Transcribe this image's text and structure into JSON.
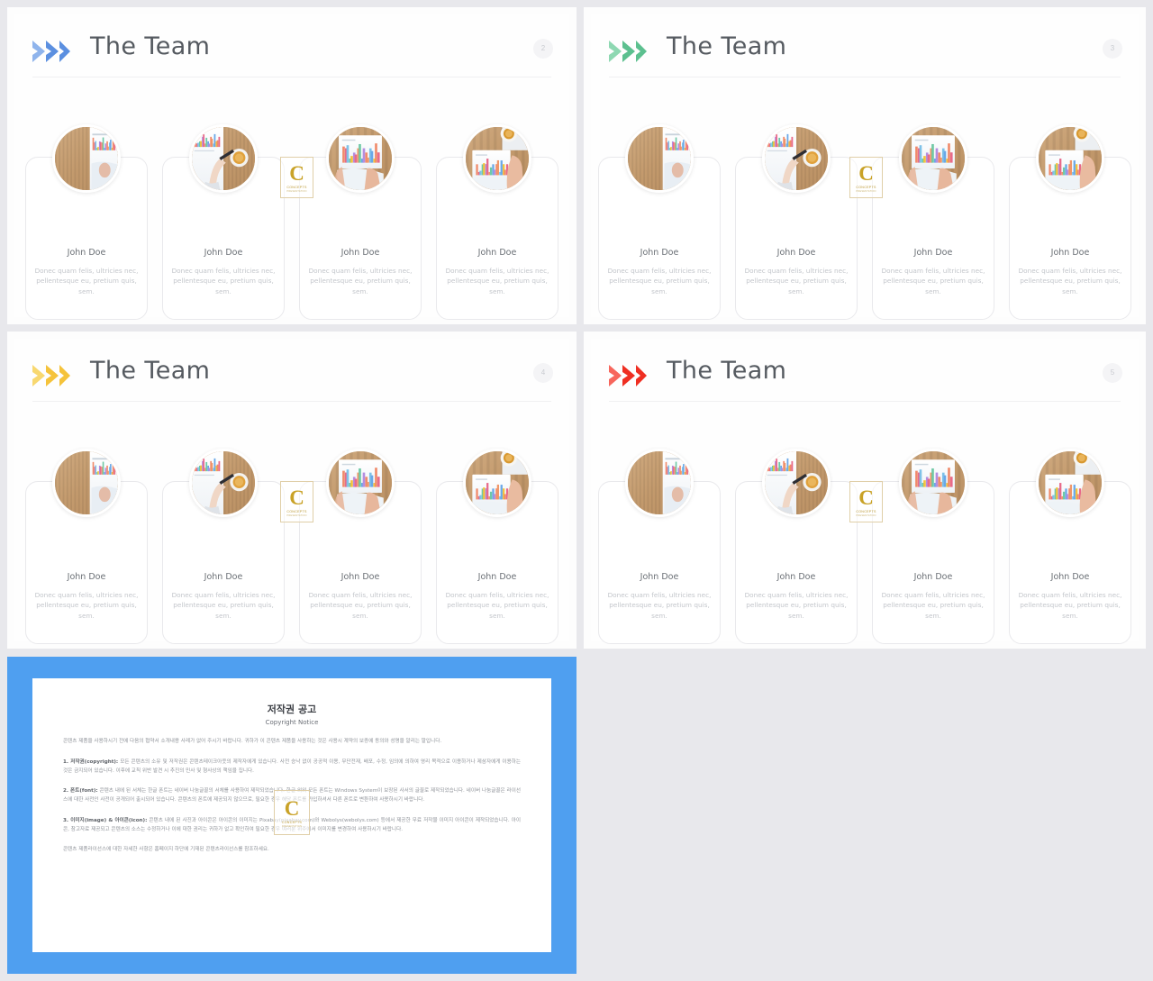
{
  "deck": {
    "slides": [
      {
        "page_number": "2",
        "title": "The Team",
        "accent": "#5b8fe0",
        "accent_light": "#8fb4ec",
        "chevron_icon": "double-chevron-right-icon"
      },
      {
        "page_number": "3",
        "title": "The Team",
        "accent": "#5cc08f",
        "accent_light": "#8ed8b2",
        "chevron_icon": "double-chevron-right-icon"
      },
      {
        "page_number": "4",
        "title": "The Team",
        "accent": "#f5c33b",
        "accent_light": "#f8d870",
        "chevron_icon": "double-chevron-right-icon"
      },
      {
        "page_number": "5",
        "title": "The Team",
        "accent": "#ef2f22",
        "accent_light": "#f7665c",
        "chevron_icon": "double-chevron-right-icon"
      }
    ],
    "members": [
      {
        "name": "John Doe",
        "description": "Donec quam felis, ultricies nec, pellentesque eu, pretium quis, sem.",
        "photo": "desk-wood-chart-paper"
      },
      {
        "name": "John Doe",
        "description": "Donec quam felis, ultricies nec, pellentesque eu, pretium quis, sem.",
        "photo": "hand-pen-chart-coffee"
      },
      {
        "name": "John Doe",
        "description": "Donec quam felis, ultricies nec, pellentesque eu, pretium quis, sem.",
        "photo": "hands-chart-paper-desk"
      },
      {
        "name": "John Doe",
        "description": "Donec quam felis, ultricies nec, pellentesque eu, pretium quis, sem.",
        "photo": "coffee-chart-hand-desk"
      }
    ],
    "watermark": {
      "letter": "C",
      "line1": "CONCEPTS",
      "line2": "PRESENTATION"
    }
  },
  "copyright": {
    "frame_color": "#4f9ff0",
    "heading_ko": "저작권 공고",
    "heading_en": "Copyright Notice",
    "intro": "콘텐츠 제품을 사용하시기 전에 다음의 협약서 소개내용 사례가 없어 주시기 바랍니다. 귀하가 이 콘텐츠 제품을 사용하는 것은 사용시 계약의 보증에 동의와 성명을 알리는 말입니다.",
    "sections": [
      {
        "label": "1. 저작권(copyright):",
        "text": " 모든 콘텐츠의 소유 및 저작권은 콘텐츠테이크아웃의 제작자에게 있습니다. 사전 승낙 없이 공공적 이용, 무단전재, 배포, 수정, 임의에 의하여 영리 목적으로 이용하거나 제삼자에게 이용하는 것은 금지되어 있습니다. 이후에 교칙 위반 발견 시 추진의 민사 및 형사상의 책임을 집니다."
      },
      {
        "label": "2. 폰트(font):",
        "text": " 콘텐츠 내에 된 서체는 한글 폰트는 네이버 나눔글꼴의 서체를 사용하여 제작되었습니다. 한글 외의 모든 폰트는 Windows System이 보장된 사서의 글꼴로 제작되었습니다. 네이버 나눔글꼴은 라이선스에 대한 사전인 사전이 공개되어 출시되어 있습니다. 콘텐츠의 폰트에 제공되지 않으므로, 필요한 경우 해당 폰트를 가입하셔서 다른 폰트로 변환하여 사용하시기 바랍니다."
      },
      {
        "label": "3. 이미지(image) & 아이콘(icon):",
        "text": " 콘텐츠 내에 된 사진과 아이콘은 아이콘의 이미지는 Pixabay(pixabay.com)와 Webolys(webolys.com) 등에서 제공한 무료 저작물 이미지 아이콘이 제작되었습니다. 아이콘, 참고자료 제공되고 콘텐츠의 소스는 수정하거나 이에 대한 권리는 귀하가 없고 확인하여 필요한 경우 여러분 위주에서 이미지를 변경하여 사용하시기 바랍니다."
      }
    ],
    "footer": "콘텐츠 제품라이선스에 대한 자세한 사항은 홈페이지 하단에 기재된 콘텐츠라이선스를 참조하세요."
  }
}
